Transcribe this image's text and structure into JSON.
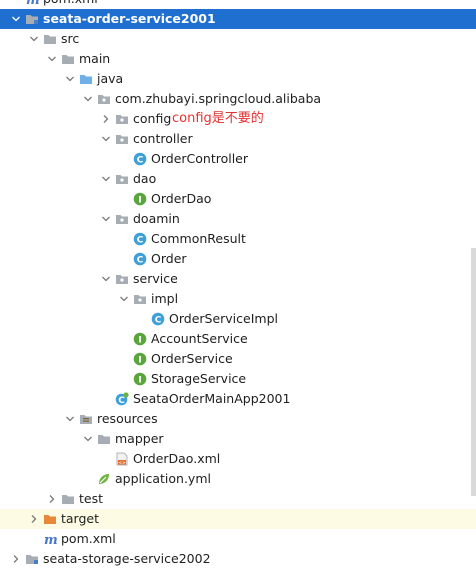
{
  "tree": [
    {
      "depth": 1,
      "arrow": "none",
      "icon": "maven-icon",
      "label": "pom.xml",
      "partial": "top"
    },
    {
      "depth": 1,
      "arrow": "down",
      "icon": "module-folder-icon",
      "label": "seata-order-service2001",
      "state": "selected"
    },
    {
      "depth": 2,
      "arrow": "down",
      "icon": "folder-icon",
      "label": "src"
    },
    {
      "depth": 3,
      "arrow": "down",
      "icon": "folder-icon",
      "label": "main"
    },
    {
      "depth": 4,
      "arrow": "down",
      "icon": "source-folder-icon",
      "label": "java"
    },
    {
      "depth": 5,
      "arrow": "down",
      "icon": "package-icon",
      "label": "com.zhubayi.springcloud.alibaba"
    },
    {
      "depth": 6,
      "arrow": "right",
      "icon": "package-icon",
      "label": "config",
      "note": "config是不要的"
    },
    {
      "depth": 6,
      "arrow": "down",
      "icon": "package-icon",
      "label": "controller"
    },
    {
      "depth": 7,
      "arrow": "none",
      "icon": "class-icon",
      "label": "OrderController"
    },
    {
      "depth": 6,
      "arrow": "down",
      "icon": "package-icon",
      "label": "dao"
    },
    {
      "depth": 7,
      "arrow": "none",
      "icon": "interface-icon",
      "label": "OrderDao"
    },
    {
      "depth": 6,
      "arrow": "down",
      "icon": "package-icon",
      "label": "doamin"
    },
    {
      "depth": 7,
      "arrow": "none",
      "icon": "class-icon",
      "label": "CommonResult"
    },
    {
      "depth": 7,
      "arrow": "none",
      "icon": "class-icon",
      "label": "Order"
    },
    {
      "depth": 6,
      "arrow": "down",
      "icon": "package-icon",
      "label": "service"
    },
    {
      "depth": 7,
      "arrow": "down",
      "icon": "package-icon",
      "label": "impl"
    },
    {
      "depth": 8,
      "arrow": "none",
      "icon": "class-icon",
      "label": "OrderServiceImpl"
    },
    {
      "depth": 7,
      "arrow": "none",
      "icon": "interface-icon",
      "label": "AccountService"
    },
    {
      "depth": 7,
      "arrow": "none",
      "icon": "interface-icon",
      "label": "OrderService"
    },
    {
      "depth": 7,
      "arrow": "none",
      "icon": "interface-icon",
      "label": "StorageService"
    },
    {
      "depth": 6,
      "arrow": "none",
      "icon": "spring-boot-app-icon",
      "label": "SeataOrderMainApp2001"
    },
    {
      "depth": 4,
      "arrow": "down",
      "icon": "resources-folder-icon",
      "label": "resources"
    },
    {
      "depth": 5,
      "arrow": "down",
      "icon": "folder-icon",
      "label": "mapper"
    },
    {
      "depth": 6,
      "arrow": "none",
      "icon": "xml-file-icon",
      "label": "OrderDao.xml"
    },
    {
      "depth": 5,
      "arrow": "none",
      "icon": "yml-spring-icon",
      "label": "application.yml"
    },
    {
      "depth": 3,
      "arrow": "right",
      "icon": "folder-icon",
      "label": "test"
    },
    {
      "depth": 2,
      "arrow": "right",
      "icon": "orange-folder-icon",
      "label": "target",
      "state": "highlight"
    },
    {
      "depth": 2,
      "arrow": "none",
      "icon": "maven-icon",
      "label": "pom.xml"
    },
    {
      "depth": 1,
      "arrow": "right",
      "icon": "module-folder-icon",
      "label": "seata-storage-service2002",
      "partial": "bottom"
    }
  ],
  "colors": {
    "selection": "#1f6fd1",
    "highlight": "#fdfbe3",
    "annotation": "#e53030",
    "folder": "#a6adb5",
    "class": "#3ea0d8",
    "interface": "#5aa63c",
    "maven": "#4a78c8"
  }
}
